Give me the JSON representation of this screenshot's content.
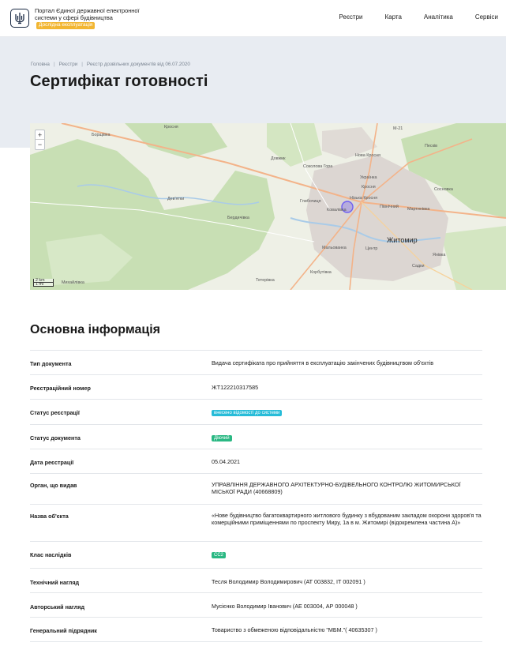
{
  "header": {
    "logo_icon": "trident-icon",
    "portal_title": "Портал Єдиної державної електронної системи у сфері будівництва",
    "badge": "Дослідна експлуатація",
    "nav": [
      "Реєстри",
      "Карта",
      "Аналітика",
      "Сервіси"
    ]
  },
  "breadcrumb": [
    "Головна",
    "Реєстри",
    "Реєстр дозвільних документів від 06.07.2020"
  ],
  "page_title": "Сертифікат готовності",
  "map": {
    "zoom_in": "+",
    "zoom_out": "−",
    "scale": [
      "2 km",
      "1 mi"
    ],
    "labels": {
      "borshchivka": "Борщівка",
      "krosnia": "Кросня",
      "dovzhyk": "Довжик",
      "sokolovska_hora": "Соколова Гора",
      "nova_krosnia": "Нова Кросня",
      "ukrainka": "Українка",
      "krosnia2": "Кросня",
      "nizhna_krosnia": "Нізька Кросня",
      "pivnichnyi": "Північний",
      "martynivka": "Мартинівка",
      "hlybochytsia": "Глибочиця",
      "deviatky": "Дев'ятки",
      "berdychivka": "Бердичівка",
      "kovalivka": "Ковалівка",
      "tsentr": "Центр",
      "zhytomyr": "Житомир",
      "malovanka": "Мальованка",
      "korbutivka": "Корбутівка",
      "tetiivka": "Тетерівка",
      "sadky": "Садки",
      "mykhailivka": "Михайлівка",
      "yanivka": "Янівка",
      "m21": "M-21",
      "piskivka": "Песків",
      "sosnivka": "Сосновка"
    },
    "colors": {
      "forest": "#c8dfb4",
      "urban": "#dcd6d2",
      "road": "#f3b389",
      "water": "#a9cbe8",
      "marker": "#6f5ff2"
    }
  },
  "section_title": "Основна інформація",
  "info": {
    "doc_type": {
      "label": "Тип документа",
      "value": "Видача сертифіката про прийняття в експлуатацію закінчених будівництвом об'єктів"
    },
    "reg_number": {
      "label": "Реєстраційний номер",
      "value": "ЖТ122210317585"
    },
    "reg_status": {
      "label": "Статус реєстрації",
      "value": "внесено відомості до системи"
    },
    "doc_status": {
      "label": "Статус документа",
      "value": "Діючий"
    },
    "reg_date": {
      "label": "Дата реєстрації",
      "value": "05.04.2021"
    },
    "issuer": {
      "label": "Орган, що видав",
      "value": "УПРАВЛІННЯ ДЕРЖАВНОГО АРХІТЕКТУРНО-БУДІВЕЛЬНОГО КОНТРОЛЮ ЖИТОМИРСЬКОЇ МІСЬКОЇ РАДИ (40668809)"
    },
    "object_name": {
      "label": "Назва об'єкта",
      "value": "«Нове будівництво багатоквартирного житлового будинку з вбудованим закладом охорони здоров'я та комерційними приміщеннями по проспекту Миру, 1а в м. Житомирі (відокремлена частина А)»"
    },
    "consequence_class": {
      "label": "Клас наслідків",
      "value": "СС2"
    },
    "tech_supervision": {
      "label": "Технічний нагляд",
      "value": "Тесля Володимир Володимирович (АТ 003832, ІТ 002091 )"
    },
    "author_supervision": {
      "label": "Авторський нагляд",
      "value": "Мусієнко Володимир Іванович (АЕ 003004, АР 000048 )"
    },
    "general_contractor": {
      "label": "Генеральний підрядник",
      "value": "Товариство з обмеженою відповідальністю \"МБМ.\"( 40635307 )"
    }
  }
}
